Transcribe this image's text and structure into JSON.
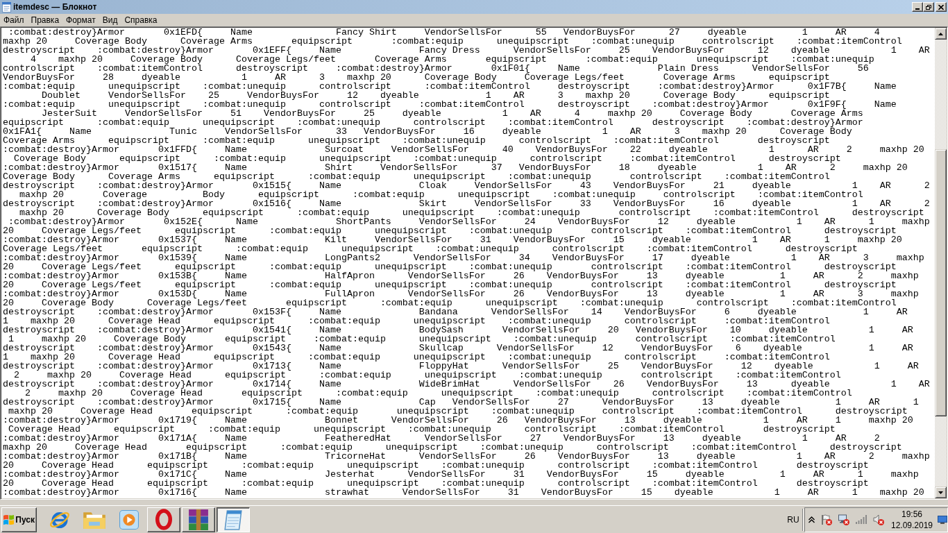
{
  "window": {
    "title": "itemdesc — Блокнот"
  },
  "menu": [
    "Файл",
    "Правка",
    "Формат",
    "Вид",
    "Справка"
  ],
  "document": {
    "lines": [
      " :combat:destroy}Armor       0x1EFD{     Name               Fancy Shirt     VendorSellsFor      55   VendorBuysFor      27     dyeable          1     AR     4",
      "maxhp 20     Coverage Body      Coverage Arms       equipscript       :combat:equip      unequipscript    :combat:unequip     controlscript    :combat:itemControl",
      "destroyscript    :combat:destroy}Armor       0x1EFF{     Name              Fancy Dress      VendorSellsFor     25    VendorBuysFor      12    dyeable           1    AR",
      "     4    maxhp 20     Coverage Body      Coverage Legs/feet       Coverage Arms       equipscript       :combat:equip       unequipscript    :combat:unequip",
      "controlscript    :combat:itemControl      destroyscript     :combat:destroy}Armor       0x1F01{     Name              Plain Dress      VendorSellsFor     56",
      "VendorBuysFor     28     dyeable           1     AR      3    maxhp 20      Coverage Body     Coverage Legs/feet       Coverage Arms      equipscript",
      ":combat:equip      unequipscript    :combat:unequip      controlscript      :combat:itemControl     destroyscript     :combat:destroy}Armor      0x1F7B{     Name",
      "       Doublet     VendorSellsFor    25     VendorBuysFor     12    dyeable            1    AR      3    maxhp 20      Coverage Body      equipscript",
      ":combat:equip      unequipscript    :combat:unequip      controlscript     :combat:itemControl      destroyscript    :combat:destroy}Armor       0x1F9F{     Name",
      "       JesterSuit     VendorSellsFor     51    VendorBuysFor     25     dyeable           1    AR      4     maxhp 20     Coverage Body       Coverage Arms",
      "equipscript      :combat:equip      unequipscript    :combat:unequip      controlscript    :combat:itemControl       destroyscript    :combat:destroy}Armor",
      "0x1FA1{     Name              Tunic     VendorSellsFor      33   VendorBuysFor     16     dyeable           1    AR      3    maxhp 20      Coverage Body",
      "Coverage Arms      equipscript      :combat:equip      unequipscript    :combat:unequip      controlscript    :combat:itemControl       destroyscript",
      ":combat:destroy}Armor       0x1FFD{     Name              Surcoat     VendorSellsFor      40    VendorBuysFor    22     dyeable           1      AR     2     maxhp 20",
      "  Coverage Body      equipscript      :combat:equip      unequipscript    :combat:unequip      controlscript     :combat:itemControl      destroyscript",
      ":combat:destroy}Armor       0x1517{     Name              Shirt     VendorSellsFor      37   VendorBuysFor     18     dyeable           1    AR      2     maxhp 20",
      "Coverage Body      Coverage Arms      equipscript      :combat:equip      unequipscript    :combat:unequip       controlscript    :combat:itemControl",
      "destroyscript    :combat:destroy}Armor       0x1515{     Name              Cloak     VendorSellsFor     43    VendorBuysFor     21     dyeable           1    AR      2",
      "   maxhp 20       Coverage          Body      equipscript      :combat:equip      unequipscript    :combat:unequip     controlscript    :combat:itemControl",
      "destroyscript    :combat:destroy}Armor       0x1516{     Name              Skirt     VendorSellsFor     33    VendorBuysFor     16     dyeable           1    AR      2",
      "   maxhp 20      Coverage Body      equipscript      :combat:equip      unequipscript    :combat:unequip       controlscript    :combat:itemControl      destroyscript",
      " :combat:destroy}Armor       0x152E{      Name              ShortPants     VendorSellsFor     24    VendorBuysFor     12     dyeable           1    AR      1     maxhp",
      "20     Coverage Legs/feet      equipscript      :combat:equip      unequipscript    :combat:unequip       controlscript    :combat:itemControl      destroyscript",
      ":combat:destroy}Armor       0x1537{     Name              Kilt     VendorSellsFor     31    VendorBuysFor     15     dyeable           1    AR      1     maxhp 20",
      "Coverage Legs/feet       equipscript      :combat:equip      unequipscript    :combat:unequip      controlscript    :combat:itemControl      destroyscript",
      ":combat:destroy}Armor       0x1539{     Name              LongPants2      VendorSellsFor     34    VendorBuysFor     17     dyeable           1    AR      3     maxhp",
      "20     Coverage Legs/feet      equipscript      :combat:equip      unequipscript    :combat:unequip       controlscript    :combat:itemControl      destroyscript",
      ":combat:destroy}Armor       0x153B{     Name              HalfApron      VendorSellsFor     26    VendorBuysFor     13     dyeable          1     AR      2     maxhp",
      "20     Coverage Legs/feet      equipscript      :combat:equip      unequipscript    :combat:unequip       controlscript    :combat:itemControl      destroyscript",
      ":combat:destroy}Armor       0x153D{     Name              FullApron      VendorSellsFor     26    VendorBuysFor     13     dyeable          1     AR      3     maxhp",
      "20     Coverage Body      Coverage Legs/feet       equipscript      :combat:equip      unequipscript    :combat:unequip      controlscript    :combat:itemControl",
      "destroyscript    :combat:destroy}Armor       0x153F{     Name              Bandana      VendorSellsFor    14    VendorBuysFor     6     dyeable            1     AR",
      "1    maxhp 20      Coverage Head      equipscript      :combat:equip      unequipscript    :combat:unequip      controlscript     :combat:itemControl",
      "destroyscript    :combat:destroy}Armor       0x1541{     Name              BodySash       VendorSellsFor     20   VendorBuysFor    10     dyeable           1     AR",
      " 1     maxhp 20     Coverage Body       equipscript     :combat:equip      unequipscript    :combat:unequip       controlscript    :combat:itemControl",
      "destroyscript    :combat:destroy}Armor       0x1543{     Name              Skullcap      VendorSellsFor     12     VendorBuysFor    6    dyeable            1     AR",
      "1    maxhp 20      Coverage Head      equipscript      :combat:equip      unequipscript    :combat:unequip      controlscript     :combat:itemControl",
      "destroyscript    :combat:destroy}Armor       0x1713{     Name              FloppyHat      VendorSellsFor     25    VendorBuysFor     12    dyeable           1     AR",
      "  2     maxhp 20     Coverage Head      equipscript      :combat:equip      unequipscript    :combat:unequip       controlscript    :combat:itemControl",
      "destroyscript    :combat:destroy}Armor       0x1714{     Name              WideBrimHat      VendorSellsFor    26    VendorBuysFor     13      dyeable           1    AR",
      "    2     maxhp 20     Coverage Head       equipscript      :combat:equip      unequipscript    :combat:unequip      controlscript    :combat:itemControl",
      "destroyscript    :combat:destroy}Armor       0x1715{     Name              Cap   VendorSellsFor     27      VendorBuysFor     13     dyeable          1     AR      1",
      " maxhp 20     Coverage Head       equipscript      :combat:equip       unequipscript    :combat:unequip     controlscript    :combat:itemControl      destroyscript",
      ":combat:destroy}Armor       0x1719{     Name              Bonnet      VendorSellsFor     26   VendorBuysFor     13     dyeable           1     AR     1     maxhp 20",
      " Coverage Head      equipscript      :combat:equip      unequipscript    :combat:unequip      controlscript    :combat:itemControl       destroyscript",
      ":combat:destroy}Armor       0x171A{     Name              FeatheredHat      VendorSellsFor     27    VendorBuysFor     13     dyeable           1     AR     2",
      "maxhp 20     Coverage Head       equipscript      :combat:equip      unequipscript    :combat:unequip      controlscript    :combat:itemControl      destroyscript",
      ":combat:destroy}Armor       0x171B{     Name              TricorneHat      VendorSellsFor     26    VendorBuysFor     13     dyeable           1    AR      2     maxhp",
      "20     Coverage Head      equipscript      :combat:equip      unequipscript    :combat:unequip      controlscript    :combat:itemControl       destroyscript",
      ":combat:destroy}Armor       0x171C{     Name              Jesterhat      VendorSellsFor     31    VendorBuysFor     15     dyeable          1     AR      1     maxhp",
      "20     Coverage Head      equipscript      :combat:equip      unequipscript    :combat:unequip      controlscript    :combat:itemControl       destroyscript",
      ":combat:destroy}Armor       0x1716{     Name              strawhat      VendorSellsFor     31    VendorBuysFor     15    dyeable           1     AR      1    maxhp 20"
    ]
  },
  "taskbar": {
    "start_label": "Пуск",
    "apps": [
      {
        "running": false,
        "selected": false
      },
      {
        "running": false,
        "selected": false
      },
      {
        "running": false,
        "selected": false
      },
      {
        "running": true,
        "selected": false
      },
      {
        "running": true,
        "selected": false
      },
      {
        "running": true,
        "selected": true
      }
    ],
    "tray": {
      "language": "RU",
      "time": "19:56",
      "date": "12.09.2019"
    }
  }
}
